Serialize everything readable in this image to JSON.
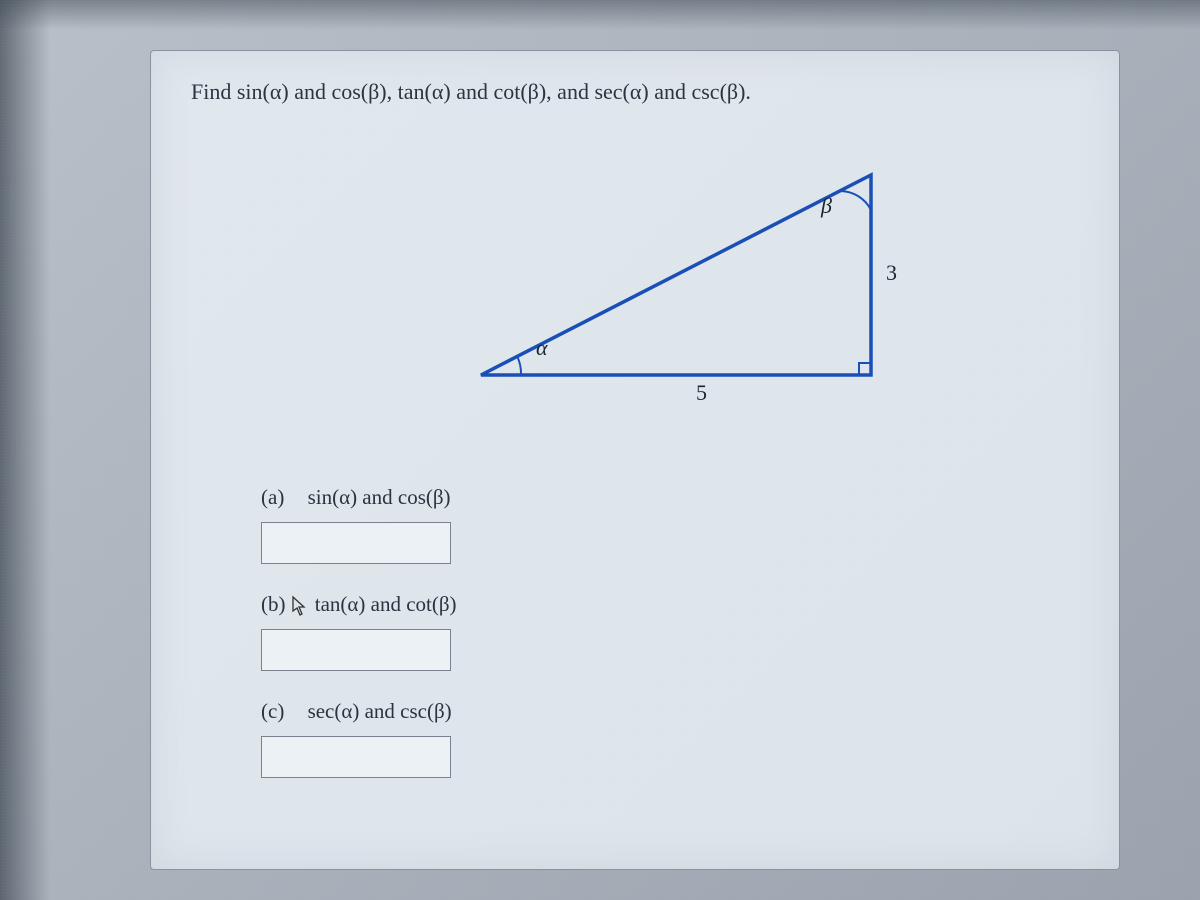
{
  "question": {
    "prompt": "Find sin(α) and cos(β), tan(α) and cot(β), and sec(α) and csc(β)."
  },
  "triangle": {
    "angle_left": "α",
    "angle_top": "β",
    "side_bottom": "5",
    "side_right": "3"
  },
  "parts": {
    "a": {
      "letter": "(a)",
      "label": "sin(α) and cos(β)"
    },
    "b": {
      "letter": "(b)",
      "label": "tan(α) and cot(β)"
    },
    "c": {
      "letter": "(c)",
      "label": "sec(α) and csc(β)"
    }
  }
}
